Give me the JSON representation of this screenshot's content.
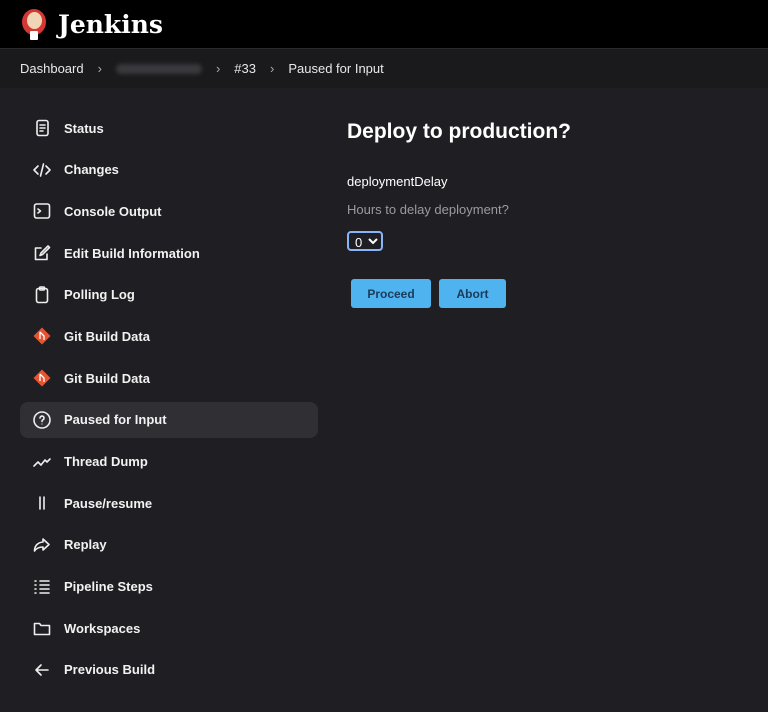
{
  "header": {
    "title": "Jenkins"
  },
  "breadcrumb": [
    "Dashboard",
    "#33",
    "Paused for Input"
  ],
  "sidebar": {
    "items": [
      {
        "label": "Status",
        "icon": "document-icon"
      },
      {
        "label": "Changes",
        "icon": "code-icon"
      },
      {
        "label": "Console Output",
        "icon": "terminal-icon"
      },
      {
        "label": "Edit Build Information",
        "icon": "edit-icon"
      },
      {
        "label": "Polling Log",
        "icon": "clipboard-icon"
      },
      {
        "label": "Git Build Data",
        "icon": "git-icon"
      },
      {
        "label": "Git Build Data",
        "icon": "git-icon"
      },
      {
        "label": "Paused for Input",
        "icon": "help-circle-icon"
      },
      {
        "label": "Thread Dump",
        "icon": "pulse-icon"
      },
      {
        "label": "Pause/resume",
        "icon": "pause-icon"
      },
      {
        "label": "Replay",
        "icon": "replay-icon"
      },
      {
        "label": "Pipeline Steps",
        "icon": "list-icon"
      },
      {
        "label": "Workspaces",
        "icon": "folder-icon"
      },
      {
        "label": "Previous Build",
        "icon": "arrow-left-icon"
      }
    ]
  },
  "main": {
    "title": "Deploy to production?",
    "param_name": "deploymentDelay",
    "param_description": "Hours to delay deployment?",
    "selected": "0",
    "proceed": "Proceed",
    "abort": "Abort"
  },
  "colors": {
    "accent": "#4fb3f0",
    "git": "#e8542f"
  }
}
